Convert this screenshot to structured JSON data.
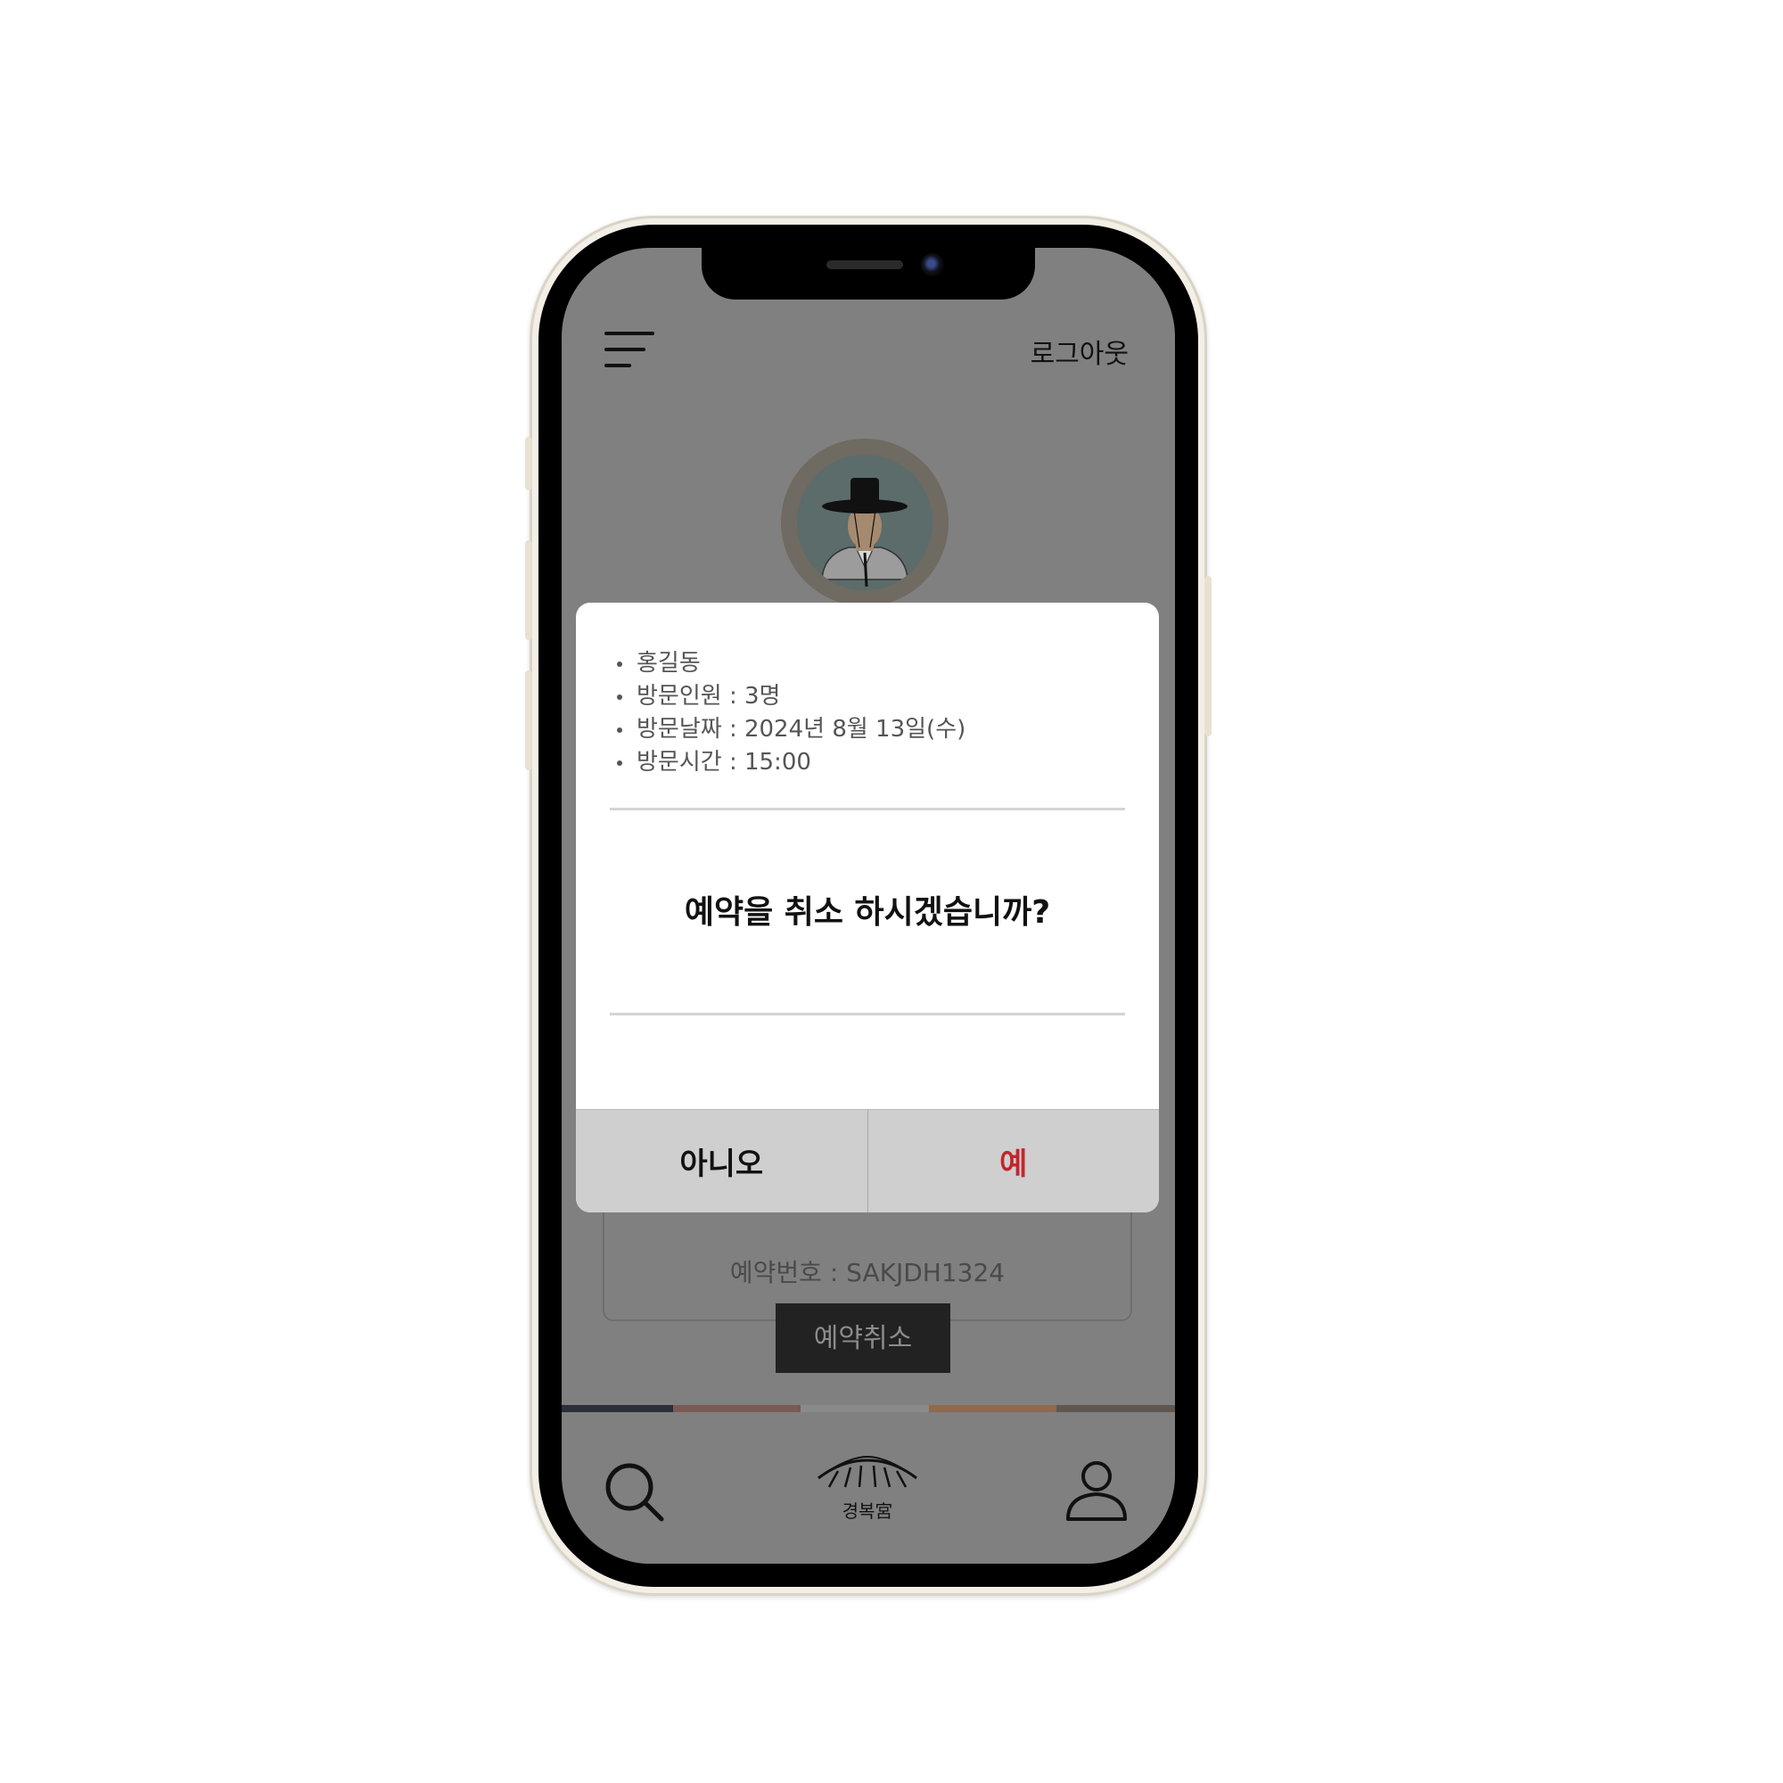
{
  "header": {
    "logout_label": "로그아웃"
  },
  "reservation_card": {
    "ticket_text": "예약번호 : SAKJDH1324"
  },
  "cancel_button_label": "예약취소",
  "dialog": {
    "details": [
      "홍길동",
      "방문인원 : 3명",
      "방문날짜 : 2024년 8월 13일(수)",
      "방문시간 : 15:00"
    ],
    "question": "예약을 취소 하시겠습니까?",
    "no_label": "아니오",
    "yes_label": "예",
    "yes_color": "#c0262d"
  },
  "bottom_nav": {
    "logo_text": "경복宮",
    "items": [
      "search-icon",
      "palace-logo-icon",
      "profile-icon"
    ]
  },
  "colors": {
    "overlay_screen": "#808080",
    "strip": [
      "#2b2f3a",
      "#7a5a52",
      "#8a8a8a",
      "#8e6a4e",
      "#5f5650"
    ]
  }
}
